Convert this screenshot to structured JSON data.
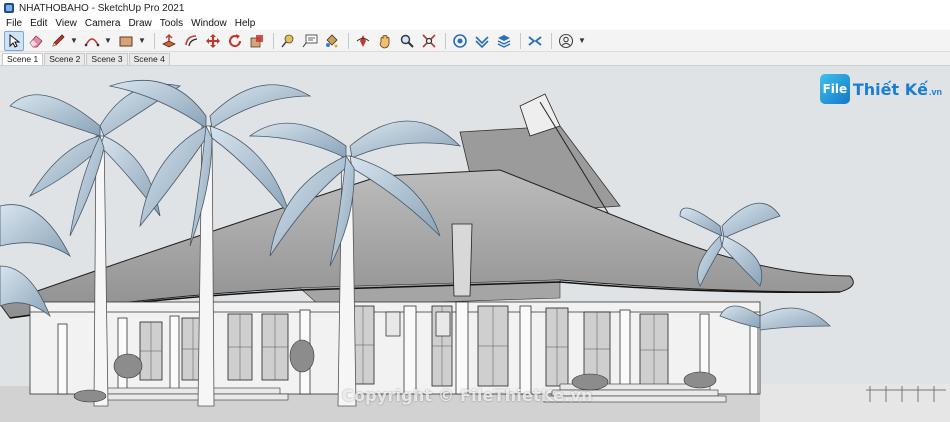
{
  "window": {
    "title": "NHATHOBAHO - SketchUp Pro 2021"
  },
  "menu": [
    "File",
    "Edit",
    "View",
    "Camera",
    "Draw",
    "Tools",
    "Window",
    "Help"
  ],
  "toolbar": {
    "tools": [
      {
        "name": "select-tool",
        "icon": "arrow-cursor-icon"
      },
      {
        "name": "eraser-tool",
        "icon": "eraser-icon"
      },
      {
        "name": "line-tool",
        "icon": "pencil-icon"
      },
      {
        "name": "arc-tool",
        "icon": "arc-icon"
      },
      {
        "name": "shapes-tool",
        "icon": "rectangle-icon"
      },
      {
        "name": "push-pull-tool",
        "icon": "push-pull-icon"
      },
      {
        "name": "offset-tool",
        "icon": "offset-icon"
      },
      {
        "name": "move-tool",
        "icon": "move-icon"
      },
      {
        "name": "rotate-tool",
        "icon": "rotate-icon"
      },
      {
        "name": "scale-tool",
        "icon": "scale-icon"
      },
      {
        "name": "tape-measure-tool",
        "icon": "tape-icon"
      },
      {
        "name": "text-tool",
        "icon": "text-icon"
      },
      {
        "name": "paint-bucket-tool",
        "icon": "paint-bucket-icon"
      },
      {
        "name": "orbit-tool",
        "icon": "orbit-icon"
      },
      {
        "name": "pan-tool",
        "icon": "hand-icon"
      },
      {
        "name": "zoom-tool",
        "icon": "magnifier-icon"
      },
      {
        "name": "zoom-extents-tool",
        "icon": "zoom-extents-icon"
      },
      {
        "name": "warehouse-tool",
        "icon": "warehouse-icon"
      },
      {
        "name": "extension-warehouse-tool",
        "icon": "extension-icon"
      },
      {
        "name": "layout-tool",
        "icon": "layers-icon"
      },
      {
        "name": "extension-manager-tool",
        "icon": "extension-manager-icon"
      },
      {
        "name": "account-tool",
        "icon": "user-icon"
      }
    ]
  },
  "scenes": [
    "Scene 1",
    "Scene 2",
    "Scene 3",
    "Scene 4"
  ],
  "brand": {
    "logo": "File",
    "name": "Thiết Kế",
    "suffix": ".vn"
  },
  "watermark": "Copyright © FileThietKe.vn",
  "colors": {
    "accent": "#1a7fd0",
    "active_tool": "#cfe3f7",
    "sky": "#e0e3e6"
  }
}
